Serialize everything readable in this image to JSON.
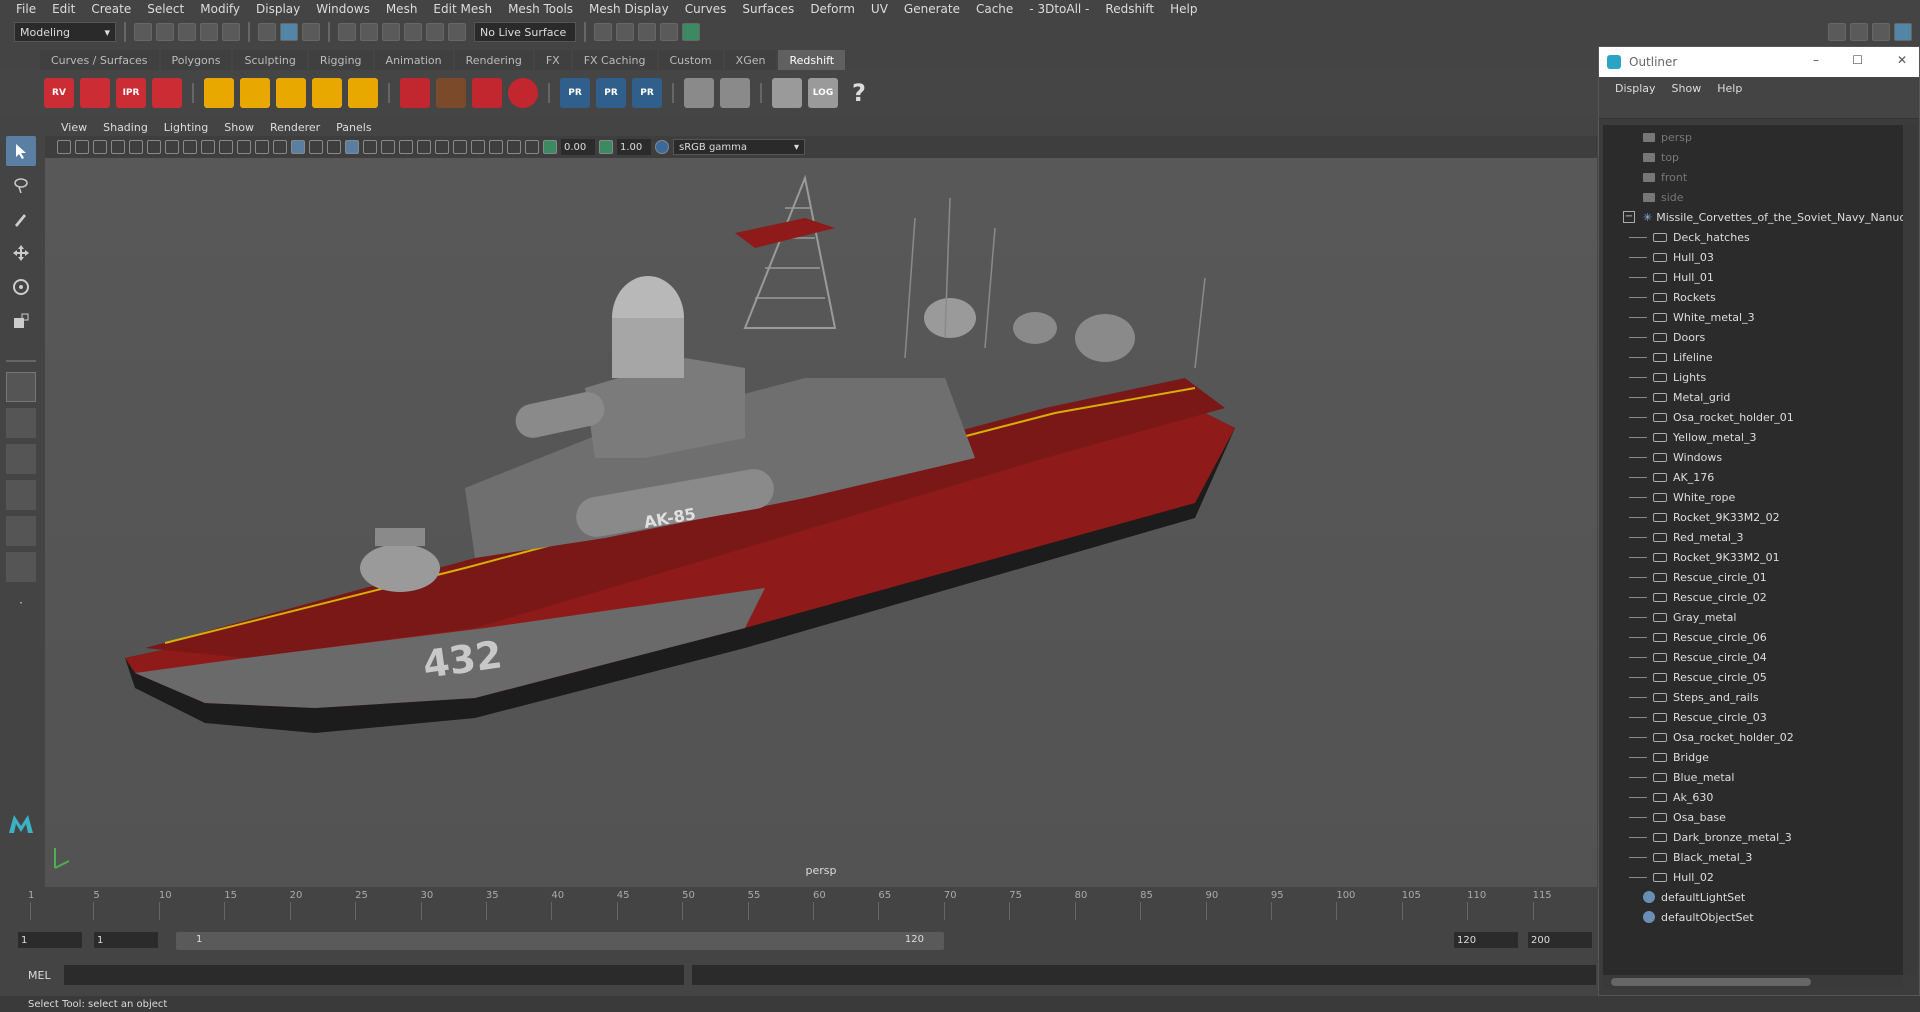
{
  "menus": [
    "File",
    "Edit",
    "Create",
    "Select",
    "Modify",
    "Display",
    "Windows",
    "Mesh",
    "Edit Mesh",
    "Mesh Tools",
    "Mesh Display",
    "Curves",
    "Surfaces",
    "Deform",
    "UV",
    "Generate",
    "Cache",
    "- 3DtoAll -",
    "Redshift",
    "Help"
  ],
  "status": {
    "mode": "Modeling",
    "live_surface": "No Live Surface"
  },
  "shelf_tabs": [
    "Curves / Surfaces",
    "Polygons",
    "Sculpting",
    "Rigging",
    "Animation",
    "Rendering",
    "FX",
    "FX Caching",
    "Custom",
    "XGen",
    "Redshift"
  ],
  "shelf_active": "Redshift",
  "shelf_labels": {
    "rv": "RV",
    "ipr": "IPR",
    "pr": "PR",
    "log": "LOG",
    "help": "?"
  },
  "viewport": {
    "menus": [
      "View",
      "Shading",
      "Lighting",
      "Show",
      "Renderer",
      "Panels"
    ],
    "exposure": "0.00",
    "gamma": "1.00",
    "colorspace": "sRGB gamma",
    "camera_label": "persp",
    "hull_number": "432",
    "turret_label": "AK-85"
  },
  "timeline": {
    "ticks": [
      "1",
      "5",
      "10",
      "15",
      "20",
      "25",
      "30",
      "35",
      "40",
      "45",
      "50",
      "55",
      "60",
      "65",
      "70",
      "75",
      "80",
      "85",
      "90",
      "95",
      "100",
      "105",
      "110",
      "115"
    ],
    "range": {
      "start1": "1",
      "start2": "1",
      "slider_start": "1",
      "slider_end": "120",
      "end1": "120",
      "end2": "200"
    }
  },
  "cmdline": {
    "label": "MEL"
  },
  "helpline": "Select Tool: select an object",
  "outliner": {
    "title": "Outliner",
    "menu": [
      "Display",
      "Show",
      "Help"
    ],
    "cameras": [
      "persp",
      "top",
      "front",
      "side"
    ],
    "root": "Missile_Corvettes_of_the_Soviet_Navy_Nanuchka",
    "children": [
      "Deck_hatches",
      "Hull_03",
      "Hull_01",
      "Rockets",
      "White_metal_3",
      "Doors",
      "Lifeline",
      "Lights",
      "Metal_grid",
      "Osa_rocket_holder_01",
      "Yellow_metal_3",
      "Windows",
      "AK_176",
      "White_rope",
      "Rocket_9K33M2_02",
      "Red_metal_3",
      "Rocket_9K33M2_01",
      "Rescue_circle_01",
      "Rescue_circle_02",
      "Gray_metal",
      "Rescue_circle_06",
      "Rescue_circle_04",
      "Rescue_circle_05",
      "Steps_and_rails",
      "Rescue_circle_03",
      "Osa_rocket_holder_02",
      "Bridge",
      "Blue_metal",
      "Ak_630",
      "Osa_base",
      "Dark_bronze_metal_3",
      "Black_metal_3",
      "Hull_02"
    ],
    "sets": [
      "defaultLightSet",
      "defaultObjectSet"
    ]
  },
  "colors": {
    "hull_red": "#8e1a1a",
    "deck_gray": "#6f6f6f",
    "accent_yellow": "#d8b000"
  }
}
